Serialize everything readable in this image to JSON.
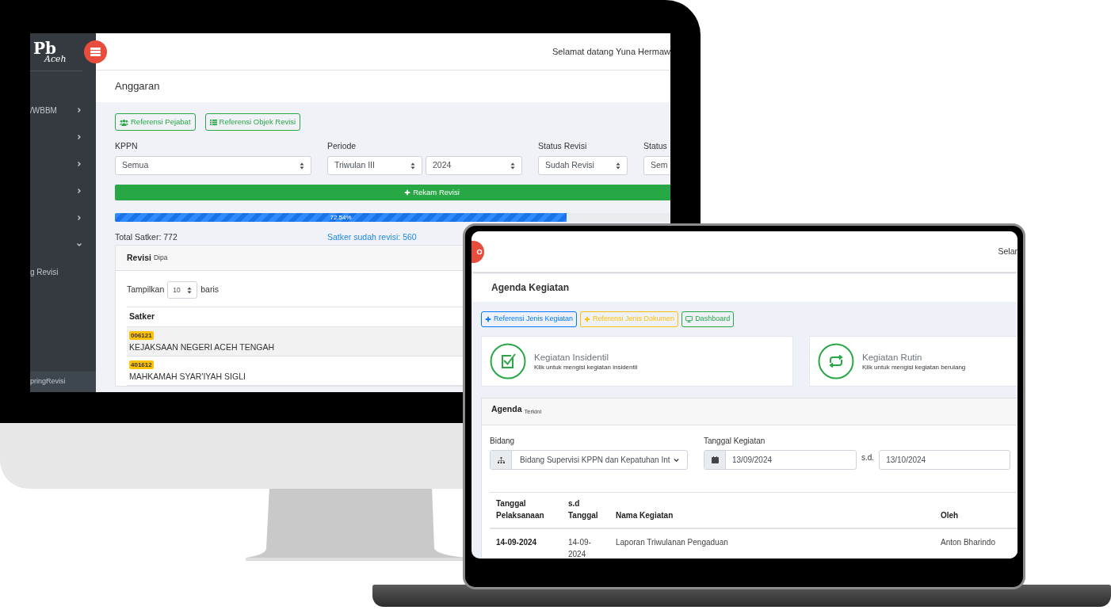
{
  "monitor": {
    "sidebar": {
      "logo": {
        "main": "Pb",
        "script": "Aceh"
      },
      "items": [
        {
          "label": "/WBBM",
          "expanded": false
        },
        {
          "expanded": false
        },
        {
          "expanded": false
        },
        {
          "expanded": false
        },
        {
          "expanded": false
        },
        {
          "expanded": true,
          "children": [
            {
              "label": "g Revisi"
            }
          ]
        }
      ],
      "footer_item": {
        "label": "pringRevisi",
        "selected": true
      }
    },
    "greeting": "Selamat datang Yuna Hermaw",
    "page_title": "Anggaran",
    "buttons": [
      {
        "label": "Referensi Pejabat",
        "kind": "users"
      },
      {
        "label": "Referensi Objek Revisi",
        "kind": "list"
      }
    ],
    "filters": [
      {
        "label": "KPPN",
        "selects": [
          "Semua"
        ]
      },
      {
        "label": "Periode",
        "selects": [
          "Triwulan III",
          "2024"
        ]
      },
      {
        "label": "Status Revisi",
        "selects": [
          "Sudah Revisi"
        ]
      },
      {
        "label": "Status",
        "selects": [
          "Sem"
        ]
      }
    ],
    "action_button": "Rekam Revisi",
    "progress": {
      "level": 0.7254,
      "reading": "72.54%"
    },
    "stats": [
      "Total Satker: 772",
      "Satker sudah revisi: 560"
    ],
    "card": {
      "title": "Revisi",
      "subtitle": "Dipa",
      "length_label": "Tampilkan",
      "length": "10",
      "length_suffix": "baris",
      "column": "Satker",
      "rows": [
        {
          "code": "006121",
          "name": "KEJAKSAAN NEGERI ACEH TENGAH"
        },
        {
          "code": "401612",
          "name": "MAHKAMAH SYAR'IYAH SIGLI"
        }
      ]
    }
  },
  "laptop": {
    "greeting": "Selar",
    "page_title": "Agenda Kegiatan",
    "buttons": [
      {
        "label": "Referensi Jenis Kegiatan",
        "kind": "plus",
        "color": "#007bff"
      },
      {
        "label": "Referensi Jenis Dokumen",
        "kind": "plus",
        "color": "#ffc107"
      },
      {
        "label": "Dashboard",
        "kind": "monitor",
        "color": "#28a745"
      }
    ],
    "tiles": [
      {
        "title": "Kegiatan Insidentil",
        "subtitle": "Klik untuk mengisi kegiatan insidentil",
        "kind": "check"
      },
      {
        "title": "Kegiatan Rutin",
        "subtitle": "Klik untuk mengisi kegiatan berulang",
        "kind": "repeat"
      }
    ],
    "agenda": {
      "title": "Agenda",
      "subtitle": "Terkini",
      "bidang_label": "Bidang",
      "bidang_value": "Bidang Supervisi KPPN dan Kepatuhan Int",
      "date_label": "Tanggal Kegiatan",
      "date_from": "13/09/2024",
      "date_separator": "s.d.",
      "date_to": "13/10/2024",
      "columns": [
        "Tanggal Pelaksanaan",
        "s.d Tanggal",
        "Nama Kegiatan",
        "Oleh"
      ],
      "rows": [
        [
          "14-09-2024",
          "14-09-2024",
          "Laporan Triwulanan Pengaduan",
          "Anton Bharindo"
        ]
      ]
    }
  }
}
